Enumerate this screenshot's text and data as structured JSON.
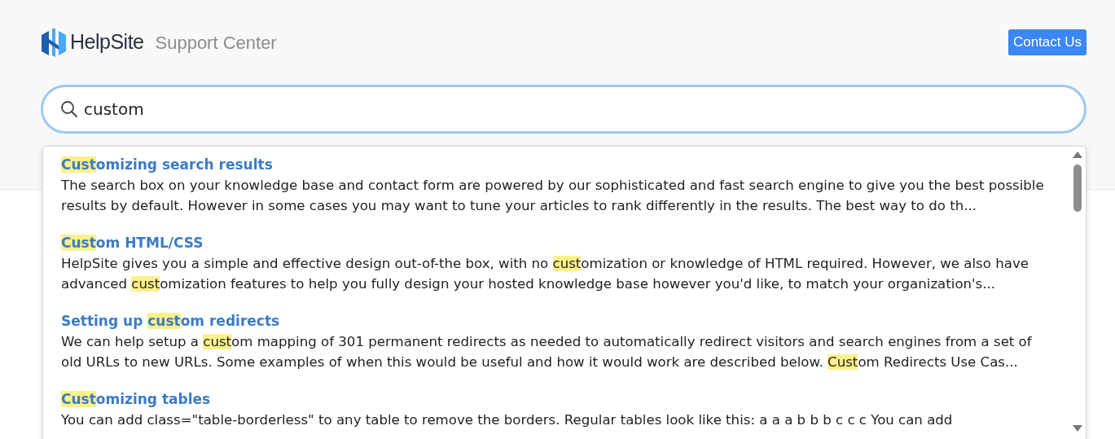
{
  "header": {
    "brand": "HelpSite",
    "subtitle": "Support Center",
    "contact_button": "Contact Us"
  },
  "search": {
    "value": "custom"
  },
  "results": [
    {
      "title": [
        {
          "text": "Cust",
          "highlight": true
        },
        {
          "text": "omizing search results",
          "highlight": false
        }
      ],
      "snippet": [
        {
          "text": "The search box on your knowledge base and contact form are powered by our sophisticated and fast search engine to give you the best possible results by default. However in some cases you may want to tune your articles to rank differently in the results. The best way to do th...",
          "highlight": false
        }
      ]
    },
    {
      "title": [
        {
          "text": "Cust",
          "highlight": true
        },
        {
          "text": "om HTML/CSS",
          "highlight": false
        }
      ],
      "snippet": [
        {
          "text": "HelpSite gives you a simple and effective design out-of-the box, with no ",
          "highlight": false
        },
        {
          "text": "cust",
          "highlight": true
        },
        {
          "text": "omization or knowledge of HTML required. However, we also have advanced ",
          "highlight": false
        },
        {
          "text": "cust",
          "highlight": true
        },
        {
          "text": "omization features to help you fully design your hosted knowledge base however you'd like, to match your organization's...",
          "highlight": false
        }
      ]
    },
    {
      "title": [
        {
          "text": "Setting up ",
          "highlight": false
        },
        {
          "text": "cust",
          "highlight": true
        },
        {
          "text": "om redirects",
          "highlight": false
        }
      ],
      "snippet": [
        {
          "text": "We can help setup a ",
          "highlight": false
        },
        {
          "text": "cust",
          "highlight": true
        },
        {
          "text": "om mapping of 301 permanent redirects  as needed to automatically redirect visitors and search engines from a set of old URLs to new URLs. Some examples of when this would be useful and how it would work are described below. ",
          "highlight": false
        },
        {
          "text": "Cust",
          "highlight": true
        },
        {
          "text": "om Redirects Use Cas...",
          "highlight": false
        }
      ]
    },
    {
      "title": [
        {
          "text": "Cust",
          "highlight": true
        },
        {
          "text": "omizing tables",
          "highlight": false
        }
      ],
      "snippet": [
        {
          "text": "You can add class=\"table-borderless\" to any table to remove the borders. Regular tables look like this: a a a b b b c c c You can add",
          "highlight": false
        }
      ]
    }
  ]
}
